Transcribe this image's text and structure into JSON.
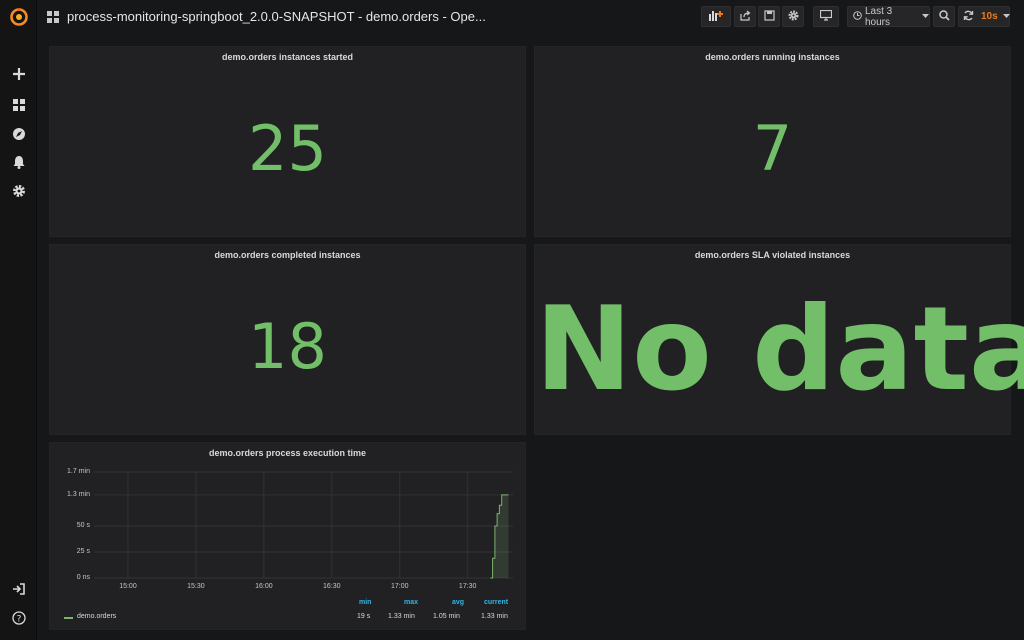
{
  "dashboard": {
    "title": "process-monitoring-springboot_2.0.0-SNAPSHOT - demo.orders - Ope..."
  },
  "topbar": {
    "time_range_label": "Last 3 hours",
    "refresh_label": "10s"
  },
  "panels": {
    "started": {
      "title": "demo.orders instances started",
      "value": "25"
    },
    "running": {
      "title": "demo.orders running instances",
      "value": "7"
    },
    "completed": {
      "title": "demo.orders completed instances",
      "value": "18"
    },
    "sla": {
      "title": "demo.orders SLA violated instances",
      "value": "No data"
    },
    "execution": {
      "title": "demo.orders process execution time"
    }
  },
  "colors": {
    "stat_green": "#73bf69",
    "legend_header": "#33b5e5",
    "refresh_orange": "#eb7b18"
  },
  "chart_data": {
    "type": "area",
    "title": "demo.orders process execution time",
    "x_ticks": [
      "15:00",
      "15:30",
      "16:00",
      "16:30",
      "17:00",
      "17:30"
    ],
    "y_ticks": [
      "1.7 min",
      "1.3 min",
      "50 s",
      "25 s",
      "0 ns"
    ],
    "ylim_seconds": [
      0,
      102
    ],
    "series": [
      {
        "name": "demo.orders",
        "x": [
          "17:40",
          "17:41",
          "17:42",
          "17:43",
          "17:44",
          "17:45",
          "17:46",
          "17:47",
          "17:48"
        ],
        "y": [
          0,
          19,
          50,
          62,
          70,
          80,
          80,
          80,
          80
        ]
      }
    ],
    "legend": {
      "headers": [
        "min",
        "max",
        "avg",
        "current"
      ],
      "rows": [
        {
          "name": "demo.orders",
          "min": "19 s",
          "max": "1.33 min",
          "avg": "1.05 min",
          "current": "1.33 min"
        }
      ]
    }
  }
}
